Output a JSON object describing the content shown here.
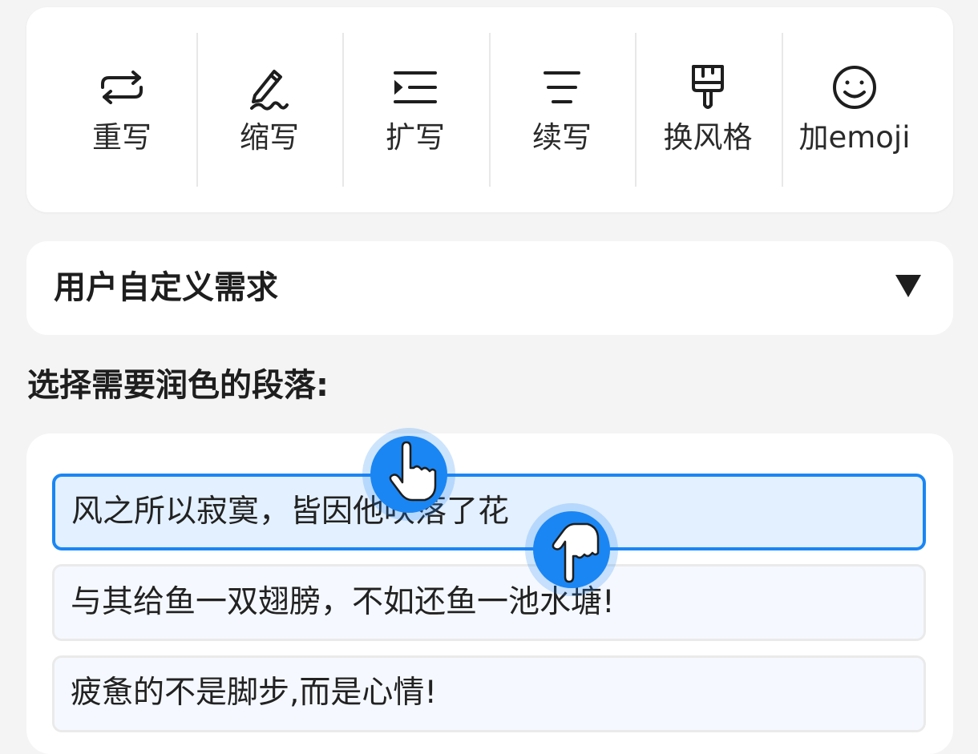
{
  "toolbar": {
    "items": [
      {
        "label": "重写",
        "icon": "rewrite-icon"
      },
      {
        "label": "缩写",
        "icon": "pen-icon"
      },
      {
        "label": "扩写",
        "icon": "indent-icon"
      },
      {
        "label": "续写",
        "icon": "lines-icon"
      },
      {
        "label": "换风格",
        "icon": "brush-icon"
      },
      {
        "label": "加emoji",
        "icon": "smiley-icon"
      }
    ]
  },
  "custom_request": {
    "title": "用户自定义需求",
    "caret": "triangle-down-icon"
  },
  "section": {
    "title": "选择需要润色的段落:"
  },
  "paragraphs": [
    {
      "text": "风之所以寂寞，皆因他吹落了花",
      "selected": true
    },
    {
      "text": "与其给鱼一双翅膀，不如还鱼一池水塘!",
      "selected": false
    },
    {
      "text": "疲惫的不是脚步,而是心情!",
      "selected": false
    }
  ],
  "colors": {
    "accent": "#1a86f4",
    "selected_bg": "#e3f0ff",
    "page_bg": "#f4f4f4"
  },
  "gesture_hints": [
    "tap-hand-icon",
    "swipe-down-hand-icon"
  ]
}
